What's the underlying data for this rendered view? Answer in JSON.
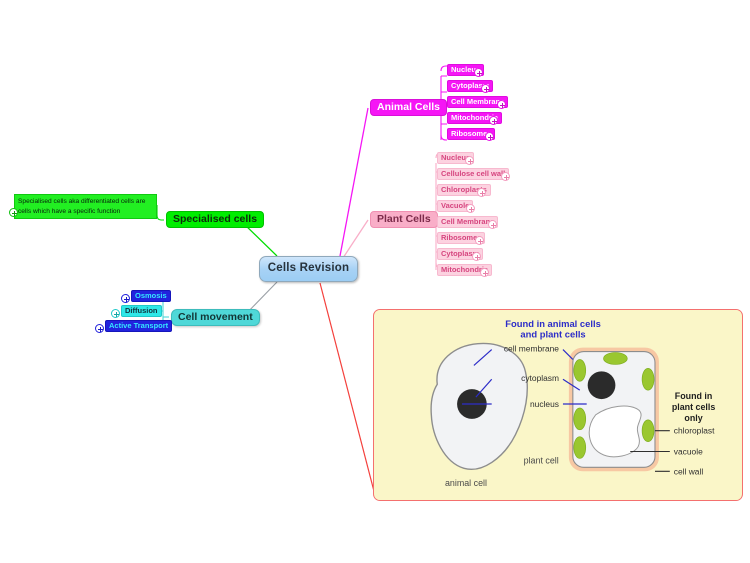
{
  "map": {
    "root": {
      "label": "Cells Revision"
    },
    "branches": [
      {
        "id": "animal-cells",
        "label": "Animal Cells",
        "color": "#f516f5",
        "children": [
          {
            "label": "Nucleus"
          },
          {
            "label": "Cytoplasm"
          },
          {
            "label": "Cell Membrane"
          },
          {
            "label": "Mitochondria"
          },
          {
            "label": "Ribosomes"
          }
        ]
      },
      {
        "id": "plant-cells",
        "label": "Plant Cells",
        "color": "#f9aec8",
        "children": [
          {
            "label": "Nucleus"
          },
          {
            "label": "Cellulose cell wall"
          },
          {
            "label": "Chloroplasts"
          },
          {
            "label": "Vacuole"
          },
          {
            "label": "Cell Membrane"
          },
          {
            "label": "Ribosomes"
          },
          {
            "label": "Cytoplasm"
          },
          {
            "label": "Mitochondria"
          }
        ]
      },
      {
        "id": "specialised-cells",
        "label": "Specialised cells",
        "color": "#00ee00",
        "note": "Specialised cells aka differentiated cells are cells which have a specific function",
        "children": []
      },
      {
        "id": "cell-movement",
        "label": "Cell movement",
        "color": "#4fd8d8",
        "children": [
          {
            "label": "Osmosis"
          },
          {
            "label": "Diffusion"
          },
          {
            "label": "Active Transport"
          }
        ]
      }
    ]
  },
  "picture": {
    "heading_line1": "Found in animal cells",
    "heading_line2": "and plant cells",
    "heading_color": "#2c2cc8",
    "labels": {
      "cell_membrane": "cell membrane",
      "cytoplasm": "cytoplasm",
      "nucleus": "nucleus",
      "animal_cell": "animal cell",
      "plant_cell": "plant cell",
      "chloroplast": "chloroplast",
      "vacuole": "vacuole",
      "cell_wall": "cell wall"
    },
    "right_heading_line1": "Found in",
    "right_heading_line2": "plant cells",
    "right_heading_line3": "only",
    "background": "#faf6c8",
    "border": "#f4706e"
  },
  "icons": {
    "expand": "plus-circle-icon"
  }
}
